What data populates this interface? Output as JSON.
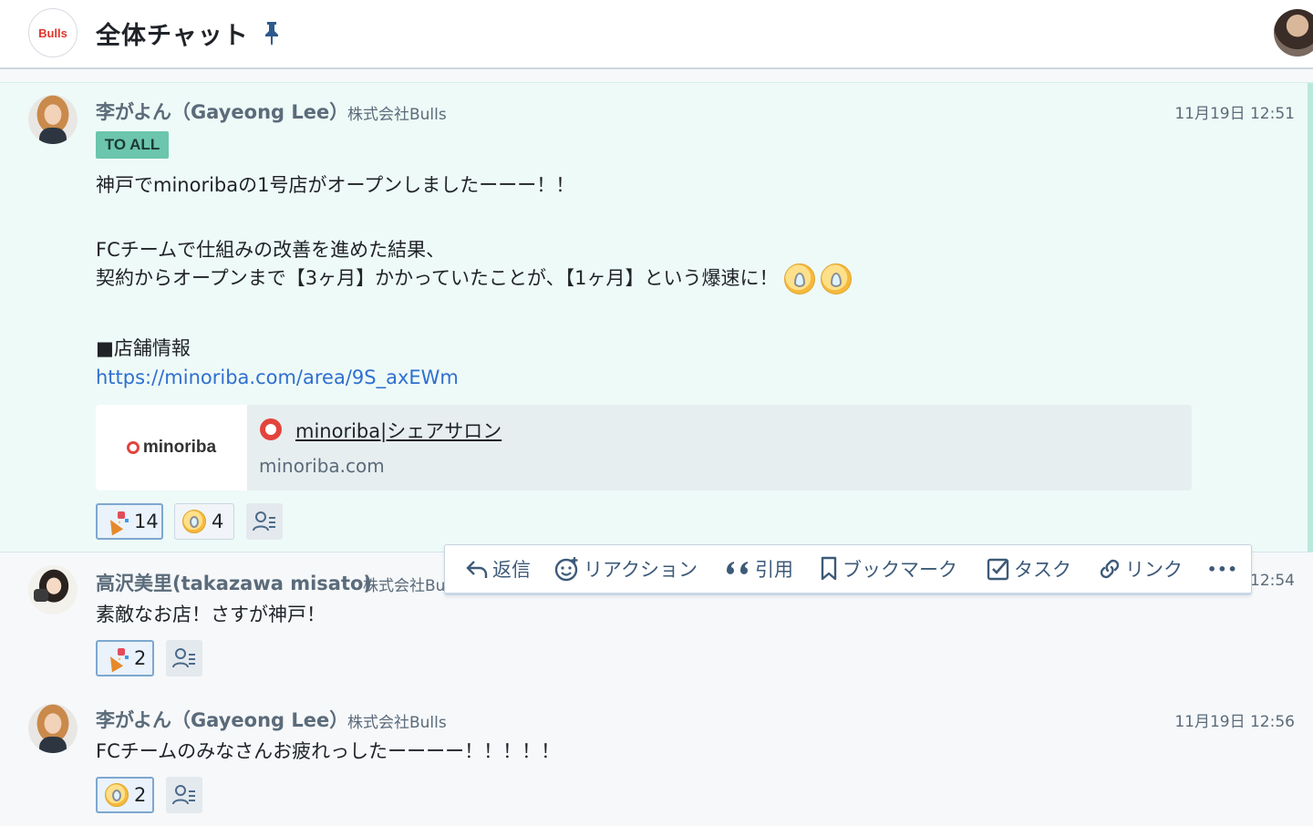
{
  "header": {
    "logo_text": "Bulls",
    "title": "全体チャット",
    "icons": [
      "pin-icon",
      "user-avatar"
    ]
  },
  "messages": [
    {
      "sender": "李がよん（Gayeong Lee）",
      "org": "株式会社Bulls",
      "time": "11月19日 12:51",
      "tag": "TO ALL",
      "lines": [
        "神戸でminoribaの1号店がオープンしましたーーー！！",
        "FCチームで仕組みの改善を進めた結果、",
        "契約からオープンまで【3ヶ月】かかっていたことが、【1ヶ月】という爆速に！",
        "■店舗情報"
      ],
      "link": "https://minoriba.com/area/9S_axEWm",
      "ogp": {
        "thumb_text": "minoriba",
        "title": "minoriba|シェアサロン",
        "domain": "minoriba.com"
      },
      "reactions": [
        {
          "icon": "party-popper-icon",
          "count": "14"
        },
        {
          "icon": "sweat-face-icon",
          "count": "4"
        }
      ]
    },
    {
      "sender": "高沢美里(takazawa misato)",
      "org": "株式会社Bu",
      "time": "12:54",
      "text": "素敵なお店！さすが神戸！",
      "reactions": [
        {
          "icon": "party-popper-icon",
          "count": "2"
        }
      ]
    },
    {
      "sender": "李がよん（Gayeong Lee）",
      "org": "株式会社Bulls",
      "time": "11月19日 12:56",
      "text": "FCチームのみなさんお疲れっしたーーーー！！！！！",
      "reactions": [
        {
          "icon": "sweat-face-icon",
          "count": "2"
        }
      ]
    }
  ],
  "toolbar": {
    "reply": "返信",
    "reaction": "リアクション",
    "quote": "引用",
    "bookmark": "ブックマーク",
    "task": "タスク",
    "link": "リンク",
    "more": "•••"
  },
  "colors": {
    "accent_tag": "#6cc5ad",
    "link": "#2f6fd0",
    "highlight_bg": "#eefaf7",
    "toolbar_text": "#3d5a78"
  }
}
